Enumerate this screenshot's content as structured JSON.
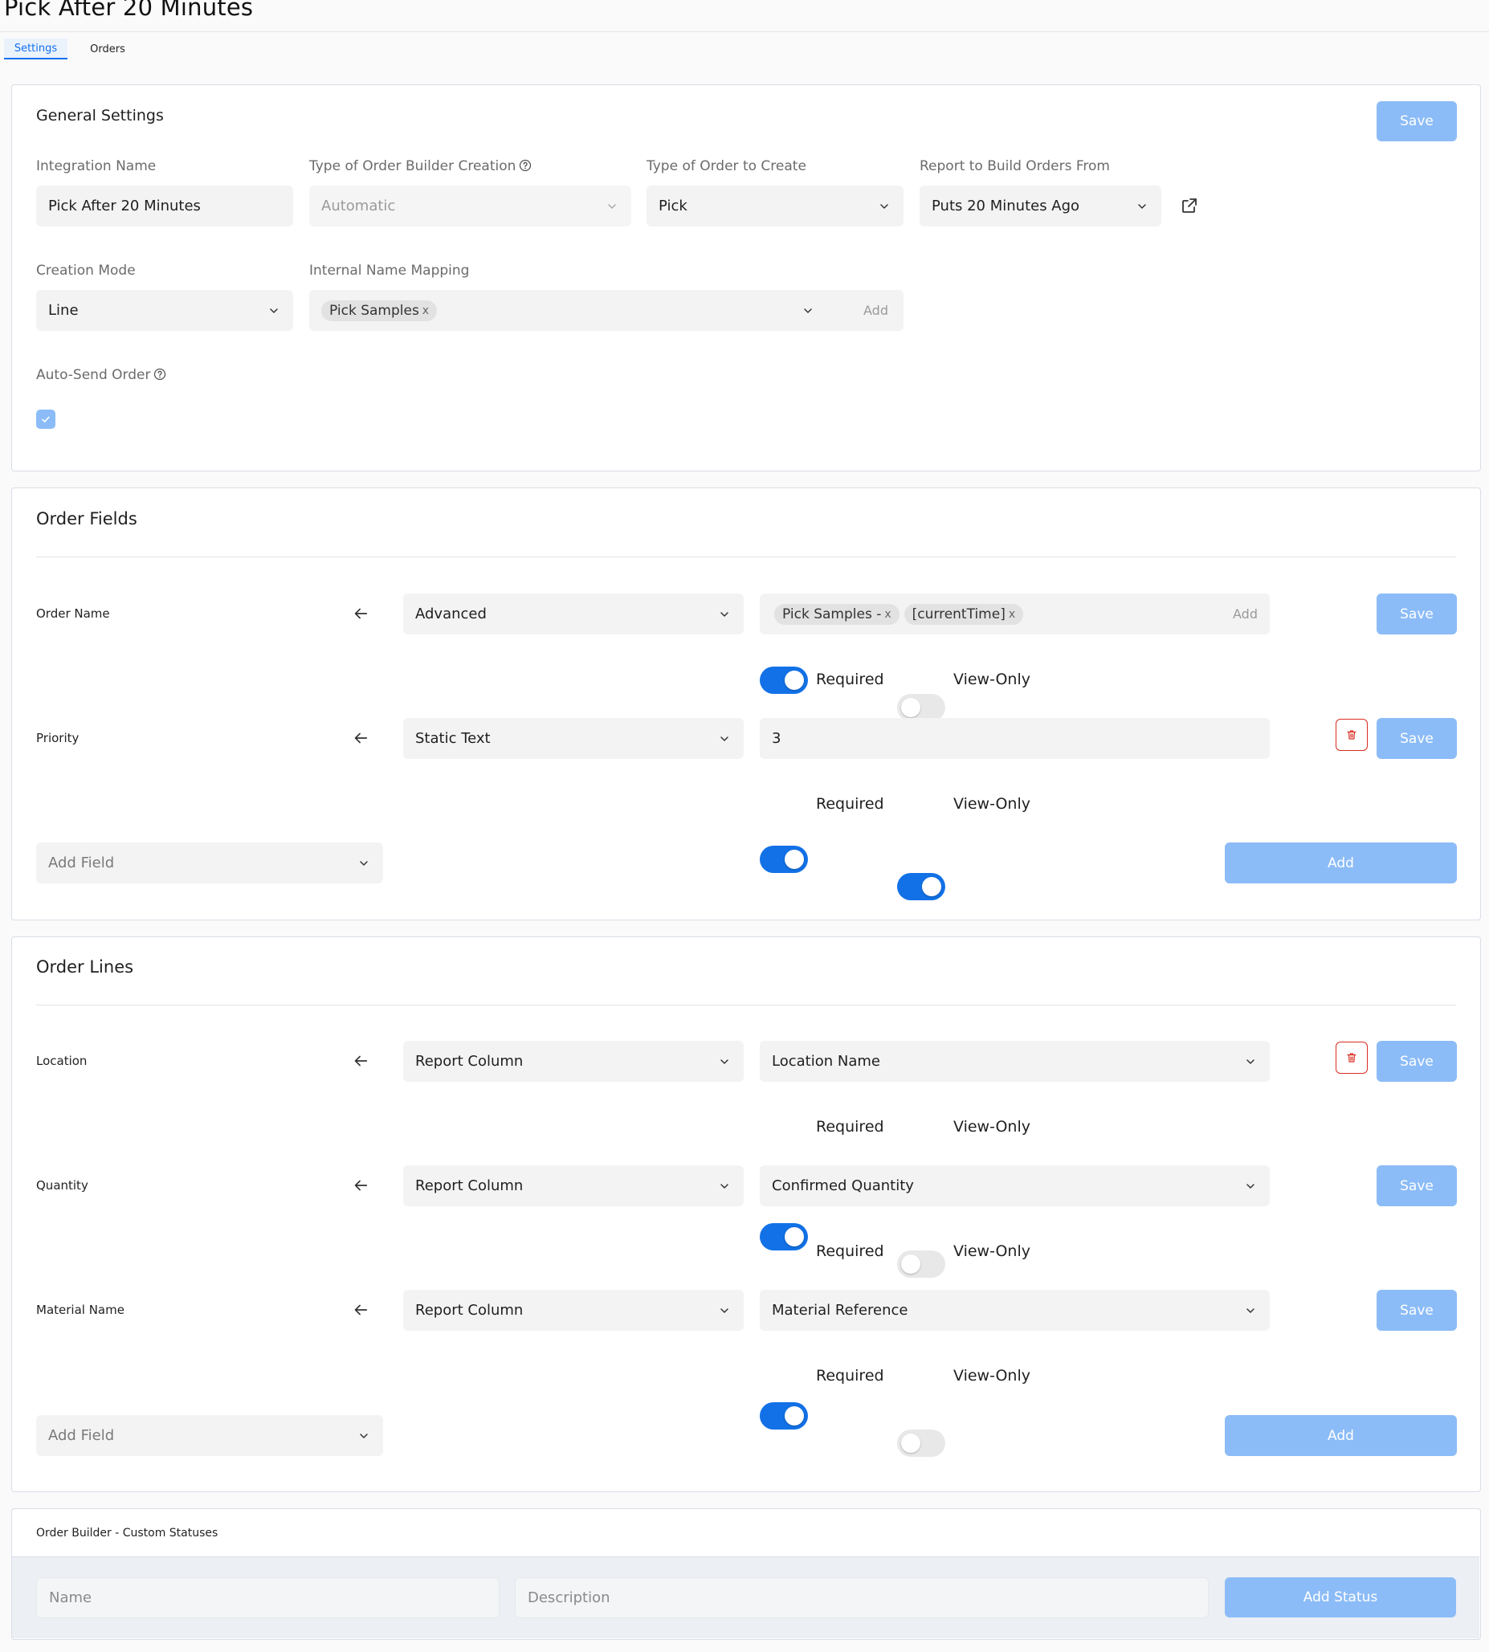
{
  "page": {
    "title": "Pick After 20 Minutes"
  },
  "tabs": [
    {
      "label": "Settings",
      "active": true
    },
    {
      "label": "Orders",
      "active": false
    }
  ],
  "general": {
    "title": "General Settings",
    "save_label": "Save",
    "integration_name": {
      "label": "Integration Name",
      "value": "Pick After 20 Minutes"
    },
    "builder_type": {
      "label": "Type of Order Builder Creation",
      "value": "Automatic"
    },
    "order_type": {
      "label": "Type of Order to Create",
      "value": "Pick"
    },
    "report": {
      "label": "Report to Build Orders From",
      "value": "Puts 20 Minutes Ago"
    },
    "creation_mode": {
      "label": "Creation Mode",
      "value": "Line"
    },
    "name_mapping": {
      "label": "Internal Name Mapping",
      "chips": [
        "Pick Samples"
      ],
      "add_label": "Add"
    },
    "auto_send": {
      "label": "Auto-Send Order",
      "checked": true
    }
  },
  "order_fields": {
    "title": "Order Fields",
    "rows": [
      {
        "label": "Order Name",
        "source": "Advanced",
        "chips": [
          "Pick Samples -",
          "[currentTime]"
        ],
        "add_label": "Add",
        "save_label": "Save",
        "required": true,
        "view_only": false,
        "required_label": "Required",
        "view_only_label": "View-Only"
      },
      {
        "label": "Priority",
        "source": "Static Text",
        "value": "3",
        "save_label": "Save",
        "required": true,
        "view_only": true,
        "required_label": "Required",
        "view_only_label": "View-Only"
      }
    ],
    "add_field_placeholder": "Add Field",
    "add_label": "Add"
  },
  "order_lines": {
    "title": "Order Lines",
    "rows": [
      {
        "label": "Location",
        "source": "Report Column",
        "value": "Location Name",
        "save_label": "Save",
        "required": true,
        "view_only": false,
        "required_label": "Required",
        "view_only_label": "View-Only"
      },
      {
        "label": "Quantity",
        "source": "Report Column",
        "value": "Confirmed Quantity",
        "save_label": "Save",
        "required": true,
        "view_only": false,
        "required_label": "Required",
        "view_only_label": "View-Only"
      },
      {
        "label": "Material Name",
        "source": "Report Column",
        "value": "Material Reference",
        "save_label": "Save",
        "required": true,
        "view_only": false,
        "required_label": "Required",
        "view_only_label": "View-Only"
      }
    ],
    "add_field_placeholder": "Add Field",
    "add_label": "Add"
  },
  "custom_statuses": {
    "title": "Order Builder - Custom Statuses",
    "name_placeholder": "Name",
    "description_placeholder": "Description",
    "add_label": "Add Status"
  },
  "icons": {
    "chevron": "chevron-down-icon",
    "help": "help-circle-icon",
    "external": "external-link-icon",
    "arrow": "arrow-left-icon",
    "trash": "trash-icon",
    "check": "check-icon"
  },
  "colors": {
    "accent": "#1271e6",
    "button": "#8cbcf7",
    "danger": "#d92d20"
  }
}
